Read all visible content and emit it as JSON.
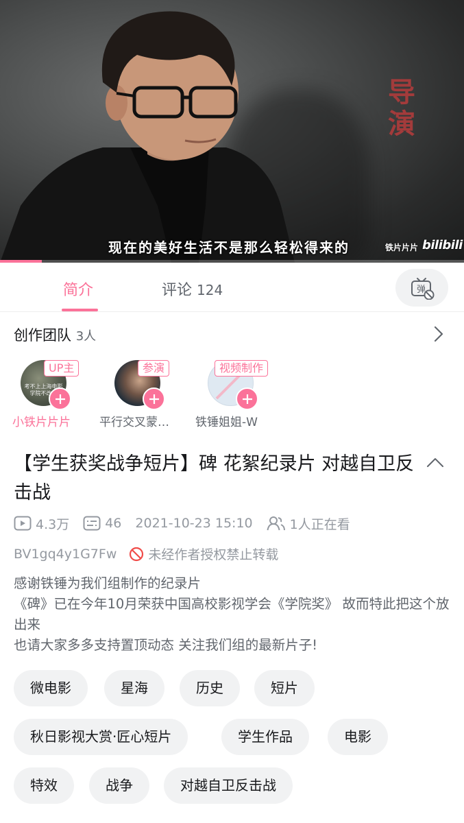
{
  "player": {
    "subtitle": "现在的美好生活不是那么轻松得来的",
    "side_caption": "导演",
    "watermark": "铁片片片",
    "logo": "bilibili",
    "progress": 0.09
  },
  "tabs": {
    "intro": "简介",
    "comments_label": "评论",
    "comments_count": "124",
    "danmaku_icon_text": "弹"
  },
  "team": {
    "label": "创作团队",
    "count": "3人",
    "members": [
      {
        "role": "UP主",
        "name": "小铁片片片",
        "avatar_text_1": "考不上上海电影",
        "avatar_text_2": "学院不改名"
      },
      {
        "role": "参演",
        "name": "平行交叉蒙…"
      },
      {
        "role": "视频制作",
        "name": "铁锤姐姐-W"
      }
    ]
  },
  "video": {
    "title": "【学生获奖战争短片】碑 花絮纪录片 对越自卫反击战",
    "views": "4.3万",
    "danmaku": "46",
    "date": "2021-10-23 15:10",
    "watching": "1人正在看",
    "bvid": "BV1gq4y1G7Fw",
    "notice": "未经作者授权禁止转载",
    "description": [
      "感谢铁锤为我们组制作的纪录片",
      "《碑》已在今年10月荣获中国高校影视学会《学院奖》 故而特此把这个放出来",
      "也请大家多多支持置顶动态 关注我们组的最新片子!"
    ]
  },
  "tags": [
    "微电影",
    "星海",
    "历史",
    "短片",
    "秋日影视大赏·匠心短片",
    "学生作品",
    "电影",
    "特效",
    "战争",
    "对越自卫反击战"
  ],
  "colors": {
    "accent": "#fb7299",
    "text": "#18191c",
    "muted": "#9499a0",
    "tag_bg": "#f1f2f3"
  }
}
